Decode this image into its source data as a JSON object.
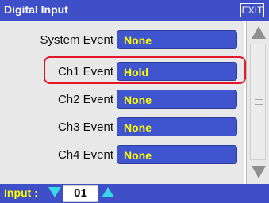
{
  "window": {
    "title": "Digital Input",
    "exit_label": "EXIT"
  },
  "rows": [
    {
      "label": "System Event",
      "value": "None"
    },
    {
      "label": "Ch1 Event",
      "value": "Hold"
    },
    {
      "label": "Ch2 Event",
      "value": "None"
    },
    {
      "label": "Ch3 Event",
      "value": "None"
    },
    {
      "label": "Ch4 Event",
      "value": "None"
    }
  ],
  "footer": {
    "input_label": "Input :",
    "input_value": "01"
  },
  "colors": {
    "title_bar": "#3f4fc8",
    "value_box": "#3e55cf",
    "value_text": "#ffff00",
    "highlight": "#e3162a",
    "arrow_cyan": "#39d6e7"
  },
  "icons": {
    "scroll_up": "triangle-up-icon",
    "scroll_down": "triangle-down-icon",
    "input_decrement": "triangle-down-icon",
    "input_increment": "triangle-up-icon"
  }
}
